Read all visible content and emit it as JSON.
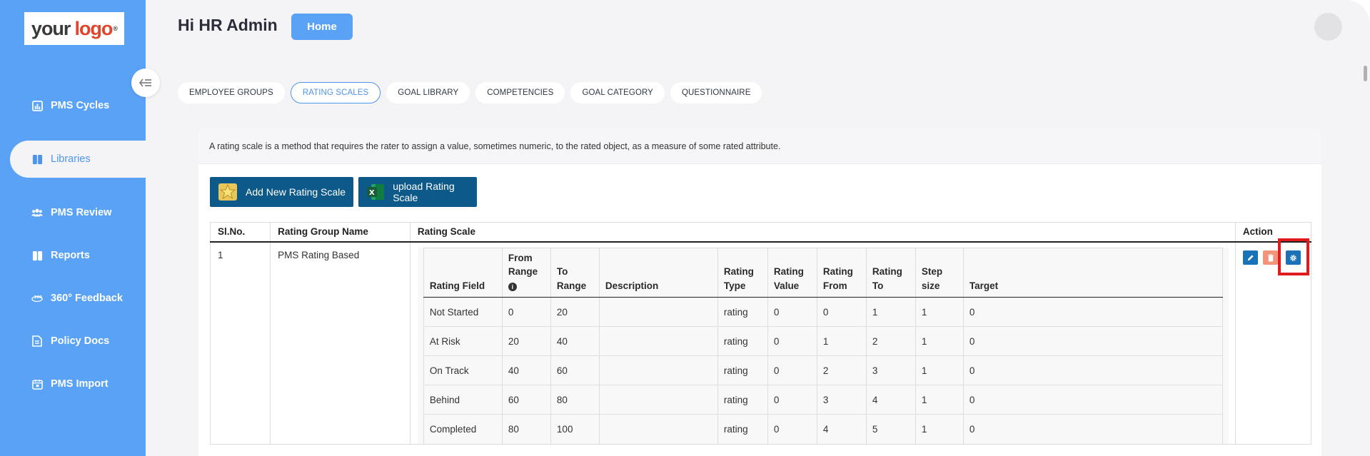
{
  "brand": {
    "logo_part1": "your",
    "logo_part2": "logo",
    "logo_mark": "®"
  },
  "sidebar": {
    "items": [
      {
        "label": "PMS Cycles",
        "icon": "bar-chart-icon"
      },
      {
        "label": "Libraries",
        "icon": "book-icon",
        "active": true
      },
      {
        "label": "PMS Review",
        "icon": "users-icon"
      },
      {
        "label": "Reports",
        "icon": "book-open-icon"
      },
      {
        "label": "360° Feedback",
        "icon": "feedback-360-icon"
      },
      {
        "label": "Policy Docs",
        "icon": "document-icon"
      },
      {
        "label": "PMS Import",
        "icon": "calendar-import-icon"
      }
    ]
  },
  "header": {
    "greeting": "Hi HR Admin",
    "home_label": "Home"
  },
  "tabs": [
    {
      "label": "EMPLOYEE GROUPS"
    },
    {
      "label": "RATING SCALES",
      "active": true
    },
    {
      "label": "GOAL LIBRARY"
    },
    {
      "label": "COMPETENCIES"
    },
    {
      "label": "GOAL CATEGORY"
    },
    {
      "label": "QUESTIONNAIRE"
    }
  ],
  "description": "A rating scale is a method that requires the rater to assign a value, sometimes numeric, to the rated object, as a measure of some rated attribute.",
  "buttons": {
    "add_label": "Add New Rating Scale",
    "upload_label": "upload Rating Scale"
  },
  "main_table": {
    "headers": {
      "sl_no": "Sl.No.",
      "group_name": "Rating Group Name",
      "scale": "Rating Scale",
      "action": "Action"
    },
    "rows": [
      {
        "sl_no": "1",
        "group_name": "PMS Rating Based"
      }
    ]
  },
  "inner_table": {
    "headers": {
      "field": "Rating Field",
      "from_range_1": "From",
      "from_range_2": "Range",
      "to_range_1": "To",
      "to_range_2": "Range",
      "description": "Description",
      "type_1": "Rating",
      "type_2": "Type",
      "value_1": "Rating",
      "value_2": "Value",
      "from_1": "Rating",
      "from_2": "From",
      "to_1": "Rating",
      "to_2": "To",
      "step_1": "Step",
      "step_2": "size",
      "target": "Target"
    },
    "rows": [
      [
        "Not Started",
        "0",
        "20",
        "",
        "rating",
        "0",
        "0",
        "1",
        "1",
        "0"
      ],
      [
        "At Risk",
        "20",
        "40",
        "",
        "rating",
        "0",
        "1",
        "2",
        "1",
        "0"
      ],
      [
        "On Track",
        "40",
        "60",
        "",
        "rating",
        "0",
        "2",
        "3",
        "1",
        "0"
      ],
      [
        "Behind",
        "60",
        "80",
        "",
        "rating",
        "0",
        "3",
        "4",
        "1",
        "0"
      ],
      [
        "Completed",
        "80",
        "100",
        "",
        "rating",
        "0",
        "4",
        "5",
        "1",
        "0"
      ]
    ]
  },
  "colors": {
    "sidebar": "#5aa2f5",
    "primary_button": "#0d5a8a",
    "highlight": "#e01b1b",
    "edit": "#1a73b8",
    "delete": "#f2947a",
    "settings": "#1a73b8"
  }
}
